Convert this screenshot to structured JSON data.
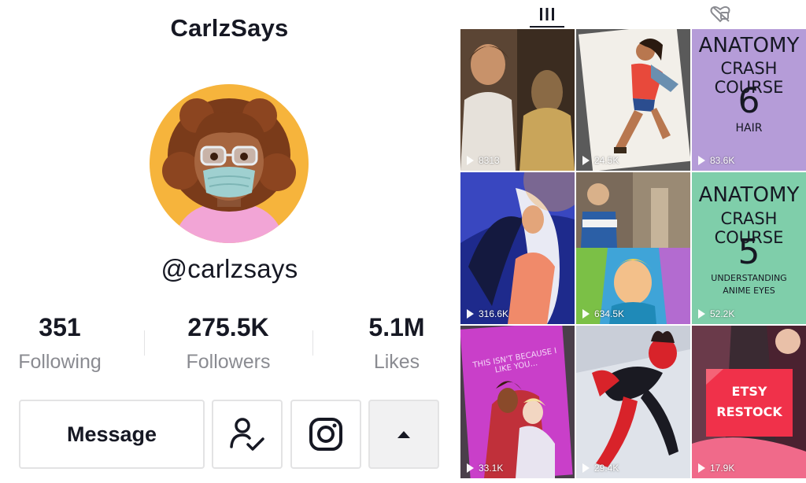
{
  "profile": {
    "title": "CarlzSays",
    "handle": "@carlzsays",
    "stats": [
      {
        "value": "351",
        "label": "Following"
      },
      {
        "value": "275.5K",
        "label": "Followers"
      },
      {
        "value": "5.1M",
        "label": "Likes"
      }
    ],
    "message_label": "Message",
    "icons": {
      "follow": "person-check-icon",
      "instagram": "instagram-icon",
      "more": "caret-up-icon"
    }
  },
  "tabs": {
    "videos_icon": "grid-videos-icon",
    "liked_icon": "liked-heart-icon"
  },
  "videos": [
    {
      "views": "8313"
    },
    {
      "views": "24.5K"
    },
    {
      "views": "83.6K",
      "poster": [
        "ANATOMY",
        "CRASH COURSE",
        "6",
        "HAIR"
      ]
    },
    {
      "views": "316.6K"
    },
    {
      "views": "634.5K"
    },
    {
      "views": "52.2K",
      "poster": [
        "ANATOMY",
        "CRASH COURSE",
        "5",
        "UNDERSTANDING",
        "ANIME EYES"
      ]
    },
    {
      "views": "33.1K",
      "overlay": "THIS ISN'T BECAUSE I LIKE YOU..."
    },
    {
      "views": "29.4K"
    },
    {
      "views": "17.9K",
      "overlay": [
        "ETSY",
        "RESTOCK"
      ]
    }
  ],
  "colors": {
    "accent": "#161823",
    "muted": "#8a8b91",
    "border": "#e3e3e4",
    "etsy_red": "#f0314a"
  }
}
